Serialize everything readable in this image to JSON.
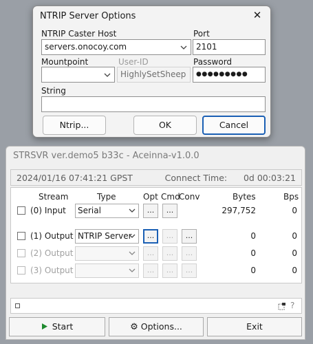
{
  "dialog": {
    "title": "NTRIP Server Options",
    "caster_host_label": "NTRIP Caster Host",
    "caster_host_value": "servers.onocoy.com",
    "port_label": "Port",
    "port_value": "2101",
    "mountpoint_label": "Mountpoint",
    "mountpoint_value": "",
    "user_id_label": "User-ID",
    "user_id_value": "HighlySetSheep",
    "password_label": "Password",
    "password_value": "●●●●●●●●●",
    "string_label": "String",
    "string_value": "",
    "ntrip_button": "Ntrip...",
    "ok_button": "OK",
    "cancel_button": "Cancel",
    "close_glyph": "✕"
  },
  "app": {
    "title": "STRSVR ver.demo5 b33c - Aceinna-v1.0.0",
    "time": "2024/01/16 07:41:21 GPST",
    "connect_time_label": "Connect Time:",
    "connect_time_value": "0d 00:03:21",
    "headers": {
      "stream": "Stream",
      "type": "Type",
      "opt": "Opt",
      "cmd": "Cmd",
      "conv": "Conv",
      "bytes": "Bytes",
      "bps": "Bps"
    },
    "rows": [
      {
        "label": "(0) Input",
        "type": "Serial",
        "bytes": "297,752",
        "bps": "0",
        "enabled": true
      },
      {
        "label": "(1) Output",
        "type": "NTRIP Server",
        "bytes": "0",
        "bps": "0",
        "enabled": true
      },
      {
        "label": "(2) Output",
        "type": "",
        "bytes": "0",
        "bps": "0",
        "enabled": false
      },
      {
        "label": "(3) Output",
        "type": "",
        "bytes": "0",
        "bps": "0",
        "enabled": false
      }
    ],
    "dots_label": "...",
    "help_glyph": "?",
    "start_button": "Start",
    "options_button": "Options...",
    "exit_button": "Exit"
  },
  "colors": {
    "accent": "#1a5fb4",
    "start_icon": "#1e8a2e"
  }
}
